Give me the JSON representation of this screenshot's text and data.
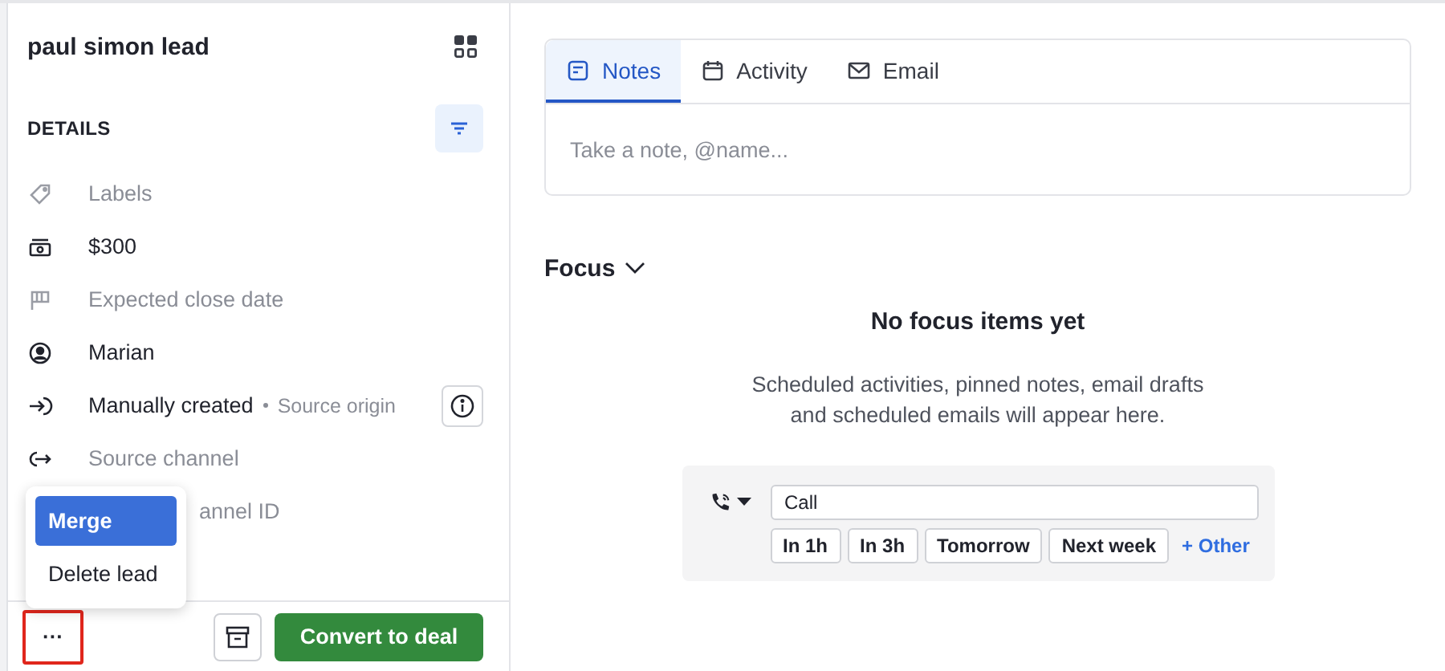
{
  "sidebar": {
    "title": "paul simon lead",
    "section_title": "DETAILS",
    "fields": [
      {
        "kind": "labels",
        "text": "Labels",
        "empty": true
      },
      {
        "kind": "value",
        "text": "$300",
        "empty": false
      },
      {
        "kind": "flag",
        "text": "Expected close date",
        "empty": true
      },
      {
        "kind": "owner",
        "text": "Marian",
        "empty": false
      },
      {
        "kind": "source",
        "text": "Manually created",
        "suffix": "Source origin",
        "empty": false
      },
      {
        "kind": "channel",
        "text": "Source channel",
        "empty": true
      },
      {
        "kind": "covered",
        "text": "annel ID",
        "empty": true
      }
    ],
    "menu": [
      {
        "label": "Merge",
        "selected": true
      },
      {
        "label": "Delete lead",
        "selected": false
      }
    ],
    "footer": {
      "more": "···",
      "convert": "Convert to deal"
    }
  },
  "composer": {
    "tabs": [
      {
        "kind": "notes",
        "label": "Notes",
        "selected": true
      },
      {
        "kind": "activity",
        "label": "Activity",
        "selected": false
      },
      {
        "kind": "email",
        "label": "Email",
        "selected": false
      }
    ],
    "placeholder": "Take a note, @name..."
  },
  "focus": {
    "title": "Focus",
    "empty_title": "No focus items yet",
    "empty_text": "Scheduled activities, pinned notes, email drafts and scheduled emails will appear here.",
    "activity": {
      "value": "Call",
      "quick": [
        "In 1h",
        "In 3h",
        "Tomorrow",
        "Next week"
      ],
      "other": "+ Other"
    }
  }
}
